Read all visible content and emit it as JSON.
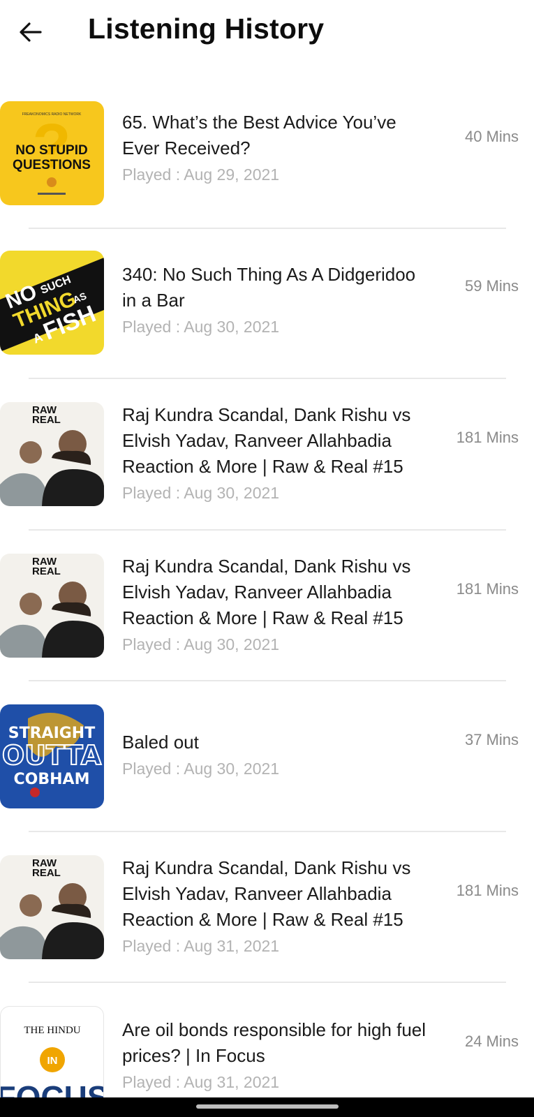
{
  "header": {
    "title": "Listening History",
    "back_icon": "arrow-left-icon"
  },
  "episodes": [
    {
      "title": "65. What’s the Best Advice You’ve Ever Received?",
      "played": "Played : Aug 29, 2021",
      "duration": "40 Mins",
      "art": {
        "lines": [
          "NO STUPID",
          "QUESTIONS"
        ],
        "top_text": "FREAKONOMICS RADIO NETWORK",
        "bg": "#f7c71d"
      }
    },
    {
      "title": "340: No Such Thing As A Didgeridoo in a Bar",
      "played": "Played : Aug 30, 2021",
      "duration": "59 Mins",
      "art": {
        "lines": [
          "NO",
          "SUCH",
          "THING",
          "AS",
          "A",
          "FISH"
        ],
        "bg": "#f2d92c"
      }
    },
    {
      "title": "Raj Kundra Scandal, Dank Rishu vs Elvish Yadav, Ranveer Allahbadia Reaction & More | Raw & Real #15",
      "played": "Played : Aug 30, 2021",
      "duration": "181 Mins",
      "art": {
        "lines": [
          "RAW",
          "REAL"
        ],
        "bg": "#f3f1ec"
      }
    },
    {
      "title": "Raj Kundra Scandal, Dank Rishu vs Elvish Yadav, Ranveer Allahbadia Reaction & More | Raw & Real #15",
      "played": "Played : Aug 30, 2021",
      "duration": "181 Mins",
      "art": {
        "lines": [
          "RAW",
          "REAL"
        ],
        "bg": "#f3f1ec"
      }
    },
    {
      "title": "Baled out",
      "played": "Played : Aug 30, 2021",
      "duration": "37 Mins",
      "art": {
        "lines": [
          "STRAIGHT",
          "OUTTA",
          "COBHAM"
        ],
        "bg": "#1f4fa8"
      }
    },
    {
      "title": "Raj Kundra Scandal, Dank Rishu vs Elvish Yadav, Ranveer Allahbadia Reaction & More | Raw & Real #15",
      "played": "Played : Aug 31, 2021",
      "duration": "181 Mins",
      "art": {
        "lines": [
          "RAW",
          "REAL"
        ],
        "bg": "#f3f1ec"
      }
    },
    {
      "title": "Are oil bonds responsible for high fuel prices? | In Focus",
      "played": "Played : Aug 31, 2021",
      "duration": "24 Mins",
      "art": {
        "lines": [
          "THE HINDU",
          "IN",
          "FOCUS"
        ],
        "bg": "#ffffff"
      }
    }
  ]
}
